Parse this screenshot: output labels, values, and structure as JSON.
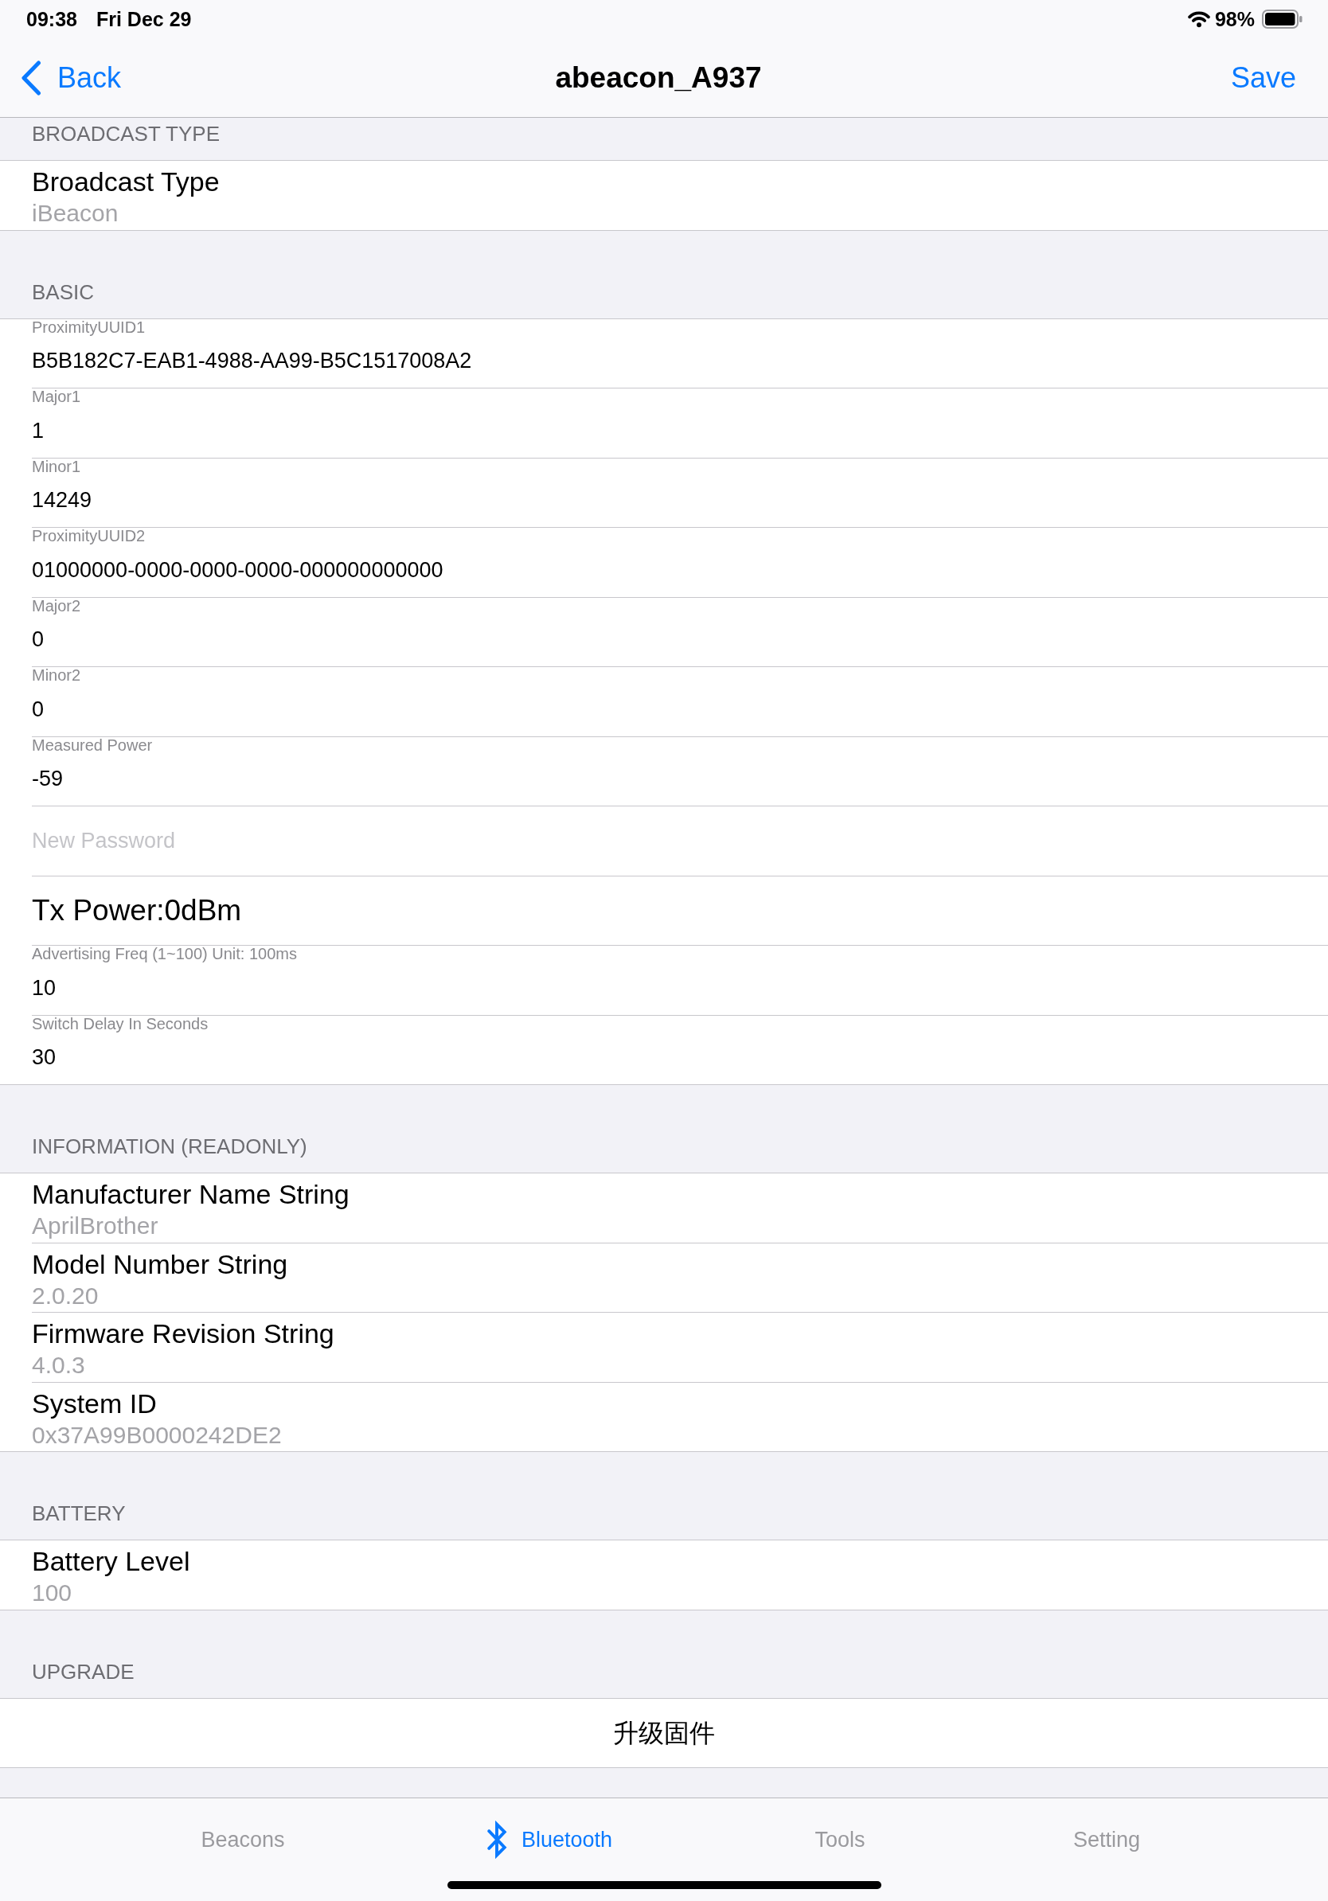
{
  "status_bar": {
    "time": "09:38",
    "date": "Fri Dec 29",
    "battery_percent": "98%"
  },
  "nav_bar": {
    "back_label": "Back",
    "title": "abeacon_A937",
    "action_label": "Save"
  },
  "sections": [
    {
      "header": "BROADCAST TYPE",
      "rows": [
        {
          "kind": "detail",
          "title": "Broadcast Type",
          "value": "iBeacon"
        }
      ]
    },
    {
      "header": "BASIC",
      "rows": [
        {
          "kind": "field",
          "label": "ProximityUUID1",
          "value": "B5B182C7-EAB1-4988-AA99-B5C1517008A2"
        },
        {
          "kind": "field",
          "label": "Major1",
          "value": "1"
        },
        {
          "kind": "field",
          "label": "Minor1",
          "value": "14249"
        },
        {
          "kind": "field",
          "label": "ProximityUUID2",
          "value": "01000000-0000-0000-0000-000000000000"
        },
        {
          "kind": "field",
          "label": "Major2",
          "value": "0"
        },
        {
          "kind": "field",
          "label": "Minor2",
          "value": "0"
        },
        {
          "kind": "field",
          "label": "Measured Power",
          "value": "-59"
        },
        {
          "kind": "field",
          "placeholder": "New Password"
        },
        {
          "kind": "option",
          "title": "Tx Power:0dBm"
        },
        {
          "kind": "field",
          "label": "Advertising Freq (1~100) Unit: 100ms",
          "value": "10"
        },
        {
          "kind": "field",
          "label": "Switch Delay In Seconds",
          "value": "30"
        }
      ]
    },
    {
      "header": "INFORMATION (READONLY)",
      "rows": [
        {
          "kind": "detail",
          "title": "Manufacturer Name String",
          "value": "AprilBrother"
        },
        {
          "kind": "detail",
          "title": "Model Number String",
          "value": "2.0.20"
        },
        {
          "kind": "detail",
          "title": "Firmware Revision String",
          "value": "4.0.3"
        },
        {
          "kind": "detail",
          "title": "System ID",
          "value": "0x37A99B0000242DE2"
        }
      ]
    },
    {
      "header": "BATTERY",
      "rows": [
        {
          "kind": "detail",
          "title": "Battery Level",
          "value": "100"
        }
      ]
    },
    {
      "header": "UPGRADE",
      "rows": [
        {
          "kind": "button",
          "title": "升级固件"
        }
      ]
    }
  ],
  "tab_bar": {
    "items": [
      {
        "label": "Beacons",
        "selected": false
      },
      {
        "label": "Bluetooth",
        "selected": true
      },
      {
        "label": "Tools",
        "selected": false
      },
      {
        "label": "Setting",
        "selected": false
      }
    ]
  }
}
